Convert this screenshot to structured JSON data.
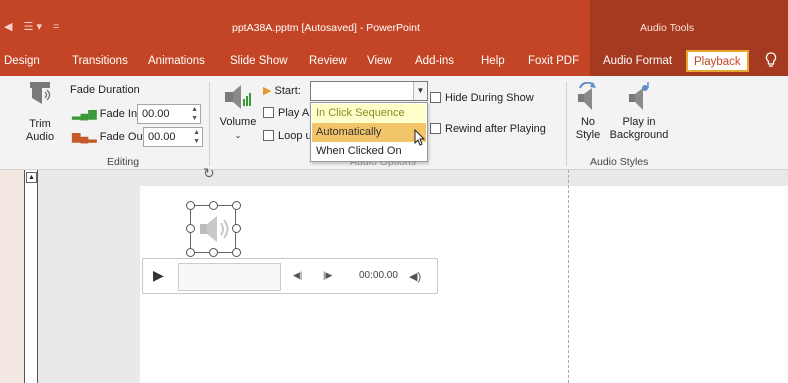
{
  "title_bar": {
    "quick_access": [
      "◀",
      "☰ ▾",
      "="
    ],
    "document_title": "pptA38A.pptm [Autosaved]  -  PowerPoint",
    "contextual_group": "Audio Tools"
  },
  "tabs": [
    "Design",
    "Transitions",
    "Animations",
    "Slide Show",
    "Review",
    "View",
    "Add-ins",
    "Help",
    "Foxit PDF",
    "Audio Format",
    "Playback"
  ],
  "active_tab": "Playback",
  "tell_me_icon": "lightbulb-icon",
  "ribbon": {
    "editing": {
      "trim_label": "Trim\nAudio",
      "fade_duration_label": "Fade Duration",
      "fade_in_label": "Fade In:",
      "fade_in_value": "00.00",
      "fade_out_label": "Fade Out:",
      "fade_out_value": "00.00",
      "group_label": "Editing"
    },
    "audio_options": {
      "volume_label": "Volume",
      "start_label": "Start:",
      "start_value": "",
      "play_across_label": "Play A",
      "loop_label": "Loop u",
      "hide_during_show_label": "Hide During Show",
      "rewind_label": "Rewind after Playing",
      "group_label": "Audio Options",
      "dropdown_options": [
        "In Click Sequence",
        "Automatically",
        "When Clicked On"
      ],
      "highlighted_option": "Automatically"
    },
    "audio_styles": {
      "no_style_label": "No\nStyle",
      "play_bg_label": "Play in\nBackground",
      "group_label": "Audio Styles"
    }
  },
  "player": {
    "time": "00:00.00"
  },
  "colors": {
    "accent": "#c34525",
    "contextual": "#a53a20",
    "highlight": "#f3c56a",
    "tab_border": "#e5a72c"
  }
}
